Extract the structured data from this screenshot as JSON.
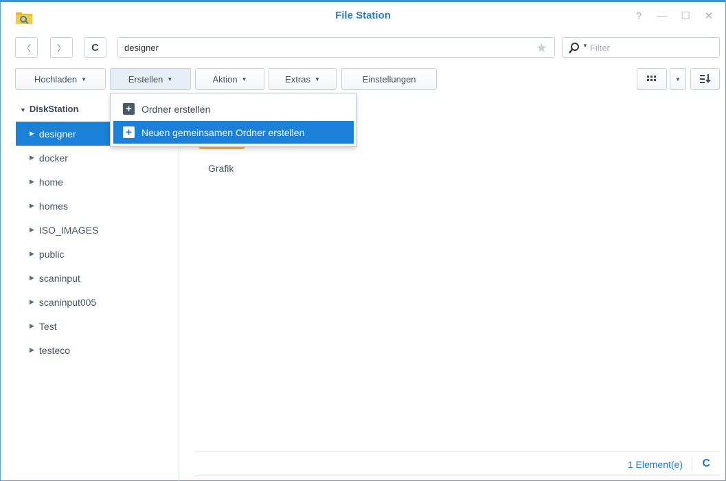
{
  "window": {
    "title": "File Station"
  },
  "titlebar": {
    "help": "?",
    "minimize": "—",
    "maximize": "☐",
    "close": "✕"
  },
  "address": {
    "back": "〈",
    "forward": "〉",
    "refresh": "C",
    "path": "designer",
    "favorite": "★"
  },
  "filter": {
    "placeholder": "Filter"
  },
  "toolbar": {
    "upload": "Hochladen",
    "create": "Erstellen",
    "action": "Aktion",
    "extras": "Extras",
    "settings": "Einstellungen"
  },
  "tree": {
    "root": "DiskStation",
    "items": [
      "designer",
      "docker",
      "home",
      "homes",
      "ISO_IMAGES",
      "public",
      "scaninput",
      "scaninput005",
      "Test",
      "testeco"
    ],
    "selected": "designer"
  },
  "menu": {
    "items": [
      {
        "label": "Ordner erstellen",
        "highlighted": false
      },
      {
        "label": "Neuen gemeinsamen Ordner erstellen",
        "highlighted": true
      }
    ]
  },
  "content": {
    "files": [
      {
        "name": "Grafik",
        "type": "folder"
      }
    ]
  },
  "status": {
    "count": "1 Element(e)"
  },
  "colors": {
    "accent": "#1a80d8",
    "title": "#2f7ec4",
    "folder": "#e4b86a"
  }
}
